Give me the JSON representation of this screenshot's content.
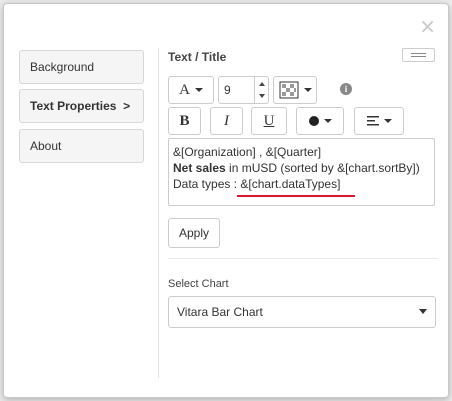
{
  "sidebar": {
    "items": [
      {
        "label": "Background"
      },
      {
        "label": "Text Properties  >"
      },
      {
        "label": "About"
      }
    ]
  },
  "section": {
    "title": "Text / Title"
  },
  "toolbar": {
    "font_label": "A",
    "font_size": "9",
    "bold_label": "B",
    "italic_label": "I",
    "underline_label": "U",
    "info_icon": "info-icon"
  },
  "editor": {
    "line1": "&[Organization] , &[Quarter]",
    "line2_bold": "Net sales",
    "line2_rest": " in mUSD (sorted by &[chart.sortBy])",
    "line3_prefix": "Data types : ",
    "line3_var": "&[chart.dataTypes]"
  },
  "apply_label": "Apply",
  "select_chart": {
    "label": "Select Chart",
    "value": "Vitara Bar Chart"
  },
  "colors": {
    "highlight": "#d9182d"
  }
}
